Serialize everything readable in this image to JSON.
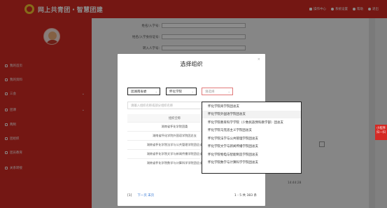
{
  "header": {
    "brand": "网上共青团・智慧团建",
    "actions": [
      {
        "label": "操作中心",
        "icon": "mail-icon"
      },
      {
        "label": "系统设置",
        "icon": "gear-icon"
      },
      {
        "label": "帮助",
        "icon": "help-icon"
      },
      {
        "label": "退出",
        "icon": "power-icon"
      }
    ]
  },
  "sidebar": {
    "items": [
      {
        "label": "我的首页",
        "chevron": ""
      },
      {
        "label": "我的资料",
        "chevron": ""
      },
      {
        "label": "三会",
        "chevron": "⌄"
      },
      {
        "label": "团课",
        "chevron": "⌄"
      },
      {
        "label": "两制",
        "chevron": ""
      },
      {
        "label": "团组织",
        "chevron": ""
      },
      {
        "label": "团员教育",
        "chevron": ""
      },
      {
        "label": "关系转接",
        "chevron": ""
      }
    ]
  },
  "background_form": {
    "fields": [
      "姓名/入学号:",
      "姓名/入学身份证号:",
      "转入人学号:"
    ]
  },
  "side_tab": {
    "line1": "小程序",
    "line2": "扫一扫"
  },
  "background_timestamp": "14:44:28",
  "modal": {
    "title": "选择组织",
    "close": "×",
    "select1": "团湖南省委",
    "select2": "怀化学院",
    "select3_placeholder": "请选择",
    "search_placeholder": "请输入组织名称或部分组织名称",
    "table": {
      "column_name": "组织全称",
      "rows": [
        {
          "name": "湖南省怀化学院团委",
          "action": "选择"
        },
        {
          "name": "湖南省怀化学院外国语学院团总支",
          "action": "选择"
        },
        {
          "name": "湖南省怀化学院法学与公共管理学院团总支",
          "action": "选择"
        },
        {
          "name": "湖南省怀化学院文学与新闻传播学院团总支",
          "action": "选择"
        },
        {
          "name": "湖南省怀化学院数学与计算科学学院团总支",
          "action": "选择"
        }
      ]
    },
    "pager": {
      "current": "[1]",
      "links": "下一页 末页",
      "total": "1 - 5 共 383 条"
    }
  },
  "dropdown": {
    "items": [
      "怀化学院商学院团总支",
      "怀化学院外国语学院团总支",
      "怀化学院教育科学学院（少数民族预科教学部）团总支",
      "怀化学院马克思主义学院团总支",
      "怀化学院法学与公共管理学院团总支",
      "怀化学院文学与新闻传播学院团总支",
      "怀化学院物电与智能制造学院团总支",
      "怀化学院数学与计算科学学院团总支"
    ],
    "hover_index": 1
  }
}
